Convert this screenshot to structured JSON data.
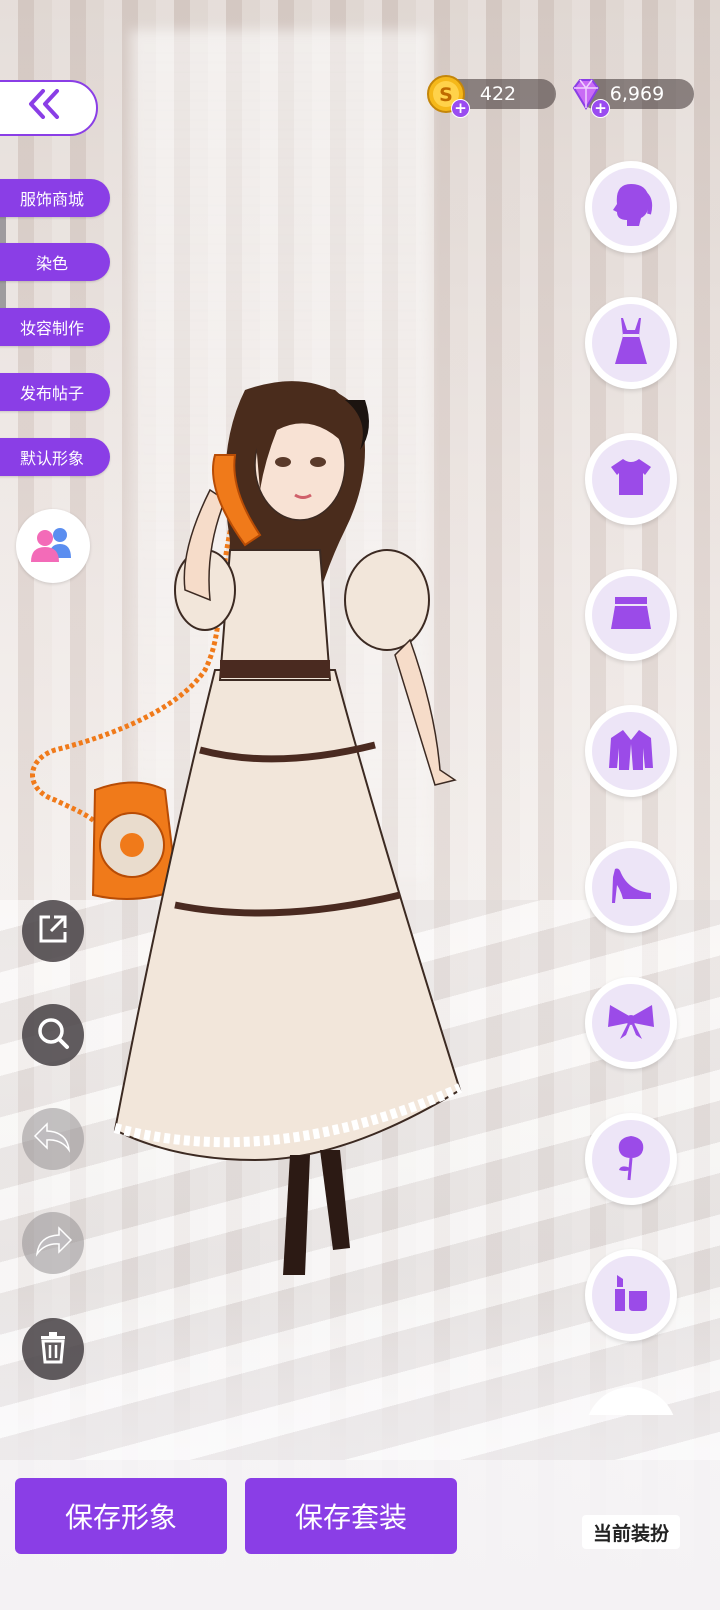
{
  "header": {
    "back_icon": "double-chevron-left-icon",
    "coins": "422",
    "gems": "6,969"
  },
  "left_menu": [
    {
      "label": "服饰商城"
    },
    {
      "label": "染色"
    },
    {
      "label": "妆容制作"
    },
    {
      "label": "发布帖子"
    },
    {
      "label": "默认形象"
    }
  ],
  "left_tools": [
    "share-icon",
    "zoom-icon",
    "undo-icon",
    "redo-icon",
    "trash-icon"
  ],
  "categories": [
    "hair-icon",
    "dress-icon",
    "top-icon",
    "skirt-icon",
    "jacket-icon",
    "shoe-icon",
    "bow-accessory-icon",
    "rose-icon",
    "makeup-icon"
  ],
  "bottom": {
    "save_look": "保存形象",
    "save_outfit": "保存套装",
    "current_outfit": "当前装扮"
  },
  "colors": {
    "accent": "#8a3ee6",
    "icon_purple": "#9b4be8",
    "phone_orange": "#f07a1a"
  }
}
